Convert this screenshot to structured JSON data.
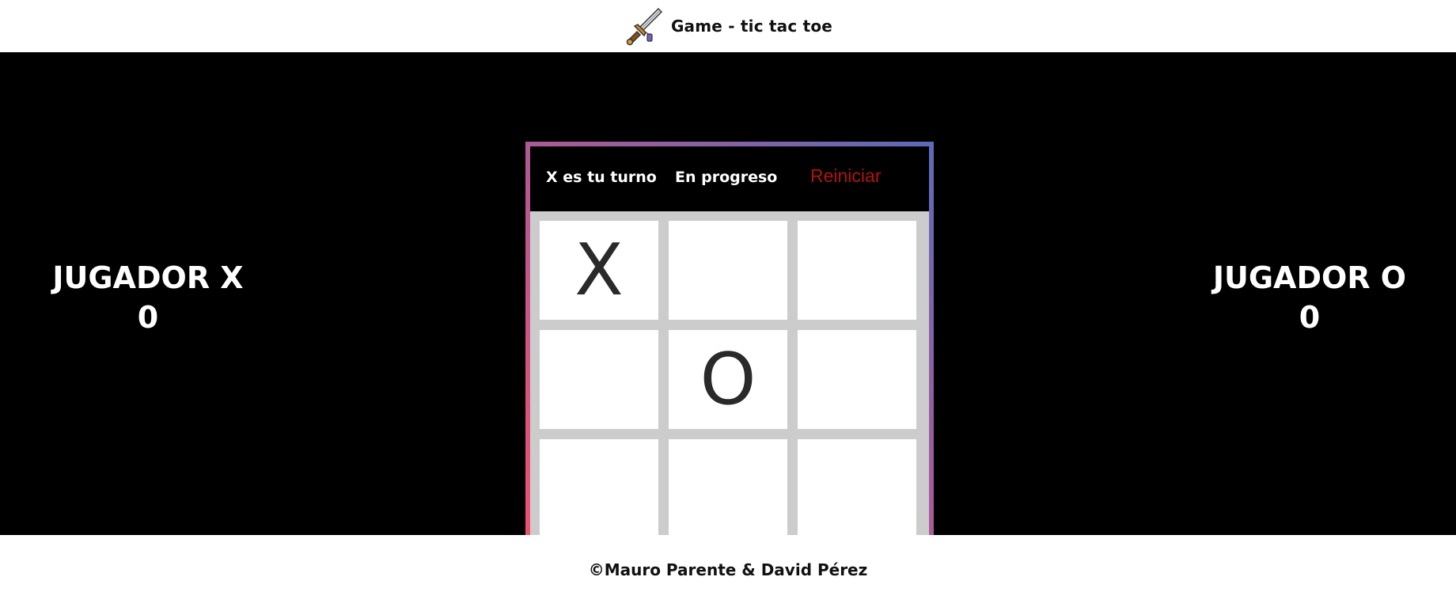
{
  "header": {
    "title": "Game - tic tac toe",
    "logo_icon": "sword-icon"
  },
  "players": {
    "x": {
      "label": "JUGADOR X",
      "score": "0"
    },
    "o": {
      "label": "JUGADOR O",
      "score": "0"
    }
  },
  "board": {
    "turn_text": "X es tu turno",
    "state_text": "En progreso",
    "reset_label": "Reiniciar",
    "cells": [
      "X",
      "",
      "",
      "",
      "O",
      "",
      "",
      "",
      ""
    ]
  },
  "footer": {
    "text": "©Mauro Parente & David Pérez"
  },
  "colors": {
    "background": "#000000",
    "reset": "#b0140f",
    "grid": "#cccccc",
    "frame_gradient": [
      "#f0506e",
      "#a85a9a",
      "#5b6ab8"
    ]
  }
}
